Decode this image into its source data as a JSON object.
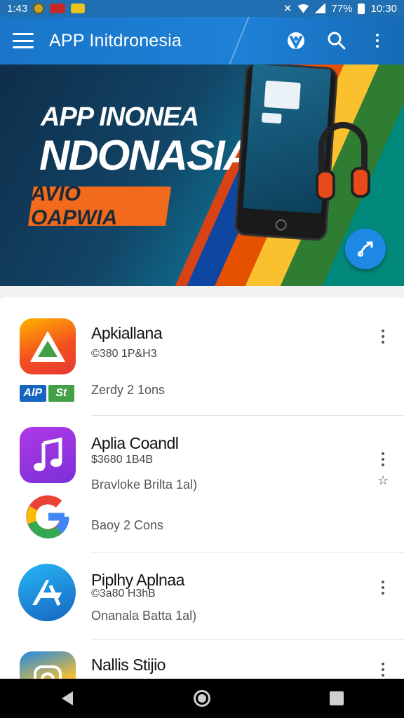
{
  "status_bar": {
    "time": "1:43",
    "battery": "77%",
    "clock_right": "10:30",
    "icons": [
      "notification-icon",
      "app-notification-icon",
      "file-notification-icon",
      "mute-icon",
      "wifi-icon",
      "signal-icon",
      "battery-icon"
    ]
  },
  "app_bar": {
    "title": "APP Initdronesia",
    "actions": [
      "shield-check-icon",
      "search-icon",
      "more-vert-icon"
    ]
  },
  "banner": {
    "line1": "APP INONEA",
    "line2": "NDONASIA",
    "tag": "AVIO OAPWIA",
    "colors": {
      "background": "#124466",
      "tag": "#f26a1b"
    }
  },
  "apps": [
    {
      "name": "Apkiallana",
      "sub": "©380 1P&H3",
      "meta": "Zerdy 2 1ons",
      "icon": "triangle-logo-icon",
      "badge": [
        "AlP",
        "St"
      ]
    },
    {
      "name": "Aplia Coandl",
      "sub": "$3680 1B4B",
      "meta": "Bravloke Brilta 1al)",
      "meta2": "Baoy 2 Cons",
      "icon": "music-note-icon",
      "secondary_icon": "google-g-icon"
    },
    {
      "name": "Piplhy Aplnaa",
      "sub": "©3a80 H3hB",
      "meta": "Onanala Batta 1al)",
      "icon": "app-store-icon"
    },
    {
      "name": "Nallis Stijio",
      "icon": "camera-icon"
    }
  ],
  "nav": [
    "back-icon",
    "home-icon",
    "recents-icon"
  ]
}
